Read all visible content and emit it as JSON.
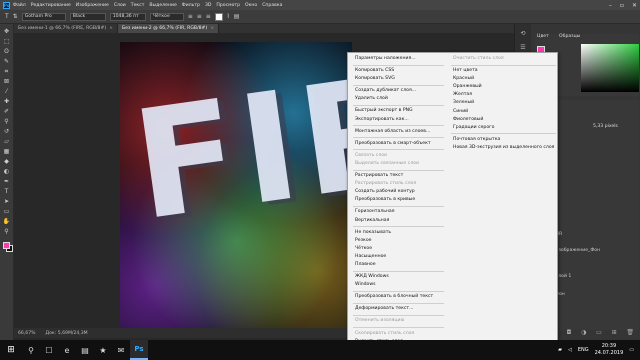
{
  "menubar": {
    "app_icon": "Ps",
    "items": [
      "Файл",
      "Редактирование",
      "Изображение",
      "Слои",
      "Текст",
      "Выделение",
      "Фильтр",
      "3D",
      "Просмотр",
      "Окно",
      "Справка"
    ]
  },
  "options": {
    "font_family": "Gotham Pro",
    "font_style": "Black",
    "font_size": "1048,36 пт",
    "antialias": "Чёткое",
    "tool_icon": "T"
  },
  "tabs": [
    {
      "label": "Без имени-1 @ 66,7% (FIRE, RGB/8#)",
      "active": false
    },
    {
      "label": "Без имени-2 @ 66,7% (FIR, RGB/8#)",
      "active": true
    }
  ],
  "artwork": {
    "text": "FIR"
  },
  "status": {
    "zoom": "66,67%",
    "doc": "Док: 5,69М/24,3М"
  },
  "context_menu": {
    "left": [
      {
        "label": "Параметры наложения...",
        "disabled": false
      },
      {
        "sep": true
      },
      {
        "label": "Копировать CSS",
        "disabled": false
      },
      {
        "label": "Копировать SVG",
        "disabled": false
      },
      {
        "sep": true
      },
      {
        "label": "Создать дубликат слоя...",
        "disabled": false
      },
      {
        "label": "Удалить слой",
        "disabled": false
      },
      {
        "sep": true
      },
      {
        "label": "Быстрый экспорт в PNG",
        "disabled": false
      },
      {
        "label": "Экспортировать как...",
        "disabled": false
      },
      {
        "sep": true
      },
      {
        "label": "Монтажная область из слоев...",
        "disabled": false
      },
      {
        "sep": true
      },
      {
        "label": "Преобразовать в смарт-объект",
        "disabled": false
      },
      {
        "sep": true
      },
      {
        "label": "Связать слои",
        "disabled": true
      },
      {
        "label": "Выделить связанные слои",
        "disabled": true
      },
      {
        "sep": true
      },
      {
        "label": "Растрировать текст",
        "disabled": false
      },
      {
        "label": "Растрировать стиль слоя",
        "disabled": true
      },
      {
        "label": "Создать рабочий контур",
        "disabled": false
      },
      {
        "label": "Преобразовать в кривые",
        "disabled": false
      },
      {
        "sep": true
      },
      {
        "label": "Горизонтальная",
        "disabled": false
      },
      {
        "label": "Вертикальная",
        "disabled": false
      },
      {
        "sep": true
      },
      {
        "label": "Не показывать",
        "disabled": false
      },
      {
        "label": "Резкое",
        "disabled": false
      },
      {
        "label": "Чёткое",
        "disabled": false
      },
      {
        "label": "Насыщенное",
        "disabled": false
      },
      {
        "label": "Плавное",
        "disabled": false
      },
      {
        "sep": true
      },
      {
        "label": "ЖКД Windows",
        "disabled": false
      },
      {
        "label": "Windows",
        "disabled": false
      },
      {
        "sep": true
      },
      {
        "label": "Преобразовать в блочный текст",
        "disabled": false
      },
      {
        "sep": true
      },
      {
        "label": "Деформировать текст...",
        "disabled": false
      },
      {
        "sep": true
      },
      {
        "label": "Отменить изоляцию",
        "disabled": true
      },
      {
        "sep": true
      },
      {
        "label": "Скопировать стиль слоя",
        "disabled": true
      },
      {
        "label": "Вклеить стиль слоя",
        "disabled": false
      }
    ],
    "right": [
      {
        "label": "Очистить стиль слоя",
        "disabled": true
      },
      {
        "sep": true
      },
      {
        "label": "Нет цвета",
        "disabled": false
      },
      {
        "label": "Красный",
        "disabled": false
      },
      {
        "label": "Оранжевый",
        "disabled": false
      },
      {
        "label": "Желтая",
        "disabled": false
      },
      {
        "label": "Зеленый",
        "disabled": false
      },
      {
        "label": "Синий",
        "disabled": false
      },
      {
        "label": "Фиолетовый",
        "disabled": false
      },
      {
        "label": "Градации серого",
        "disabled": false
      },
      {
        "sep": true
      },
      {
        "label": "Почтовая открытка",
        "disabled": false
      },
      {
        "label": "Новая 3D-экструзия из выделенного слоя",
        "disabled": false
      }
    ]
  },
  "panels": {
    "color_title": "Цвет",
    "swatches_title": "Образцы",
    "layers_title": "Слои",
    "layers": [
      {
        "name": "FIR",
        "thumb": "light"
      },
      {
        "name": "Изображение_Фон",
        "thumb": "dark"
      },
      {
        "name": "Слой 1",
        "thumb": "dark"
      },
      {
        "name": "Фон",
        "thumb": "dark"
      }
    ],
    "field_value": "5,33 pixels"
  },
  "taskbar": {
    "start_icon": "windows-logo",
    "search_icon": "⚲",
    "apps": [
      "☐",
      "e",
      "▤",
      "★",
      "✉",
      "Ps"
    ],
    "lang": "ENG",
    "time": "20:39",
    "date": "24.07.2019"
  }
}
